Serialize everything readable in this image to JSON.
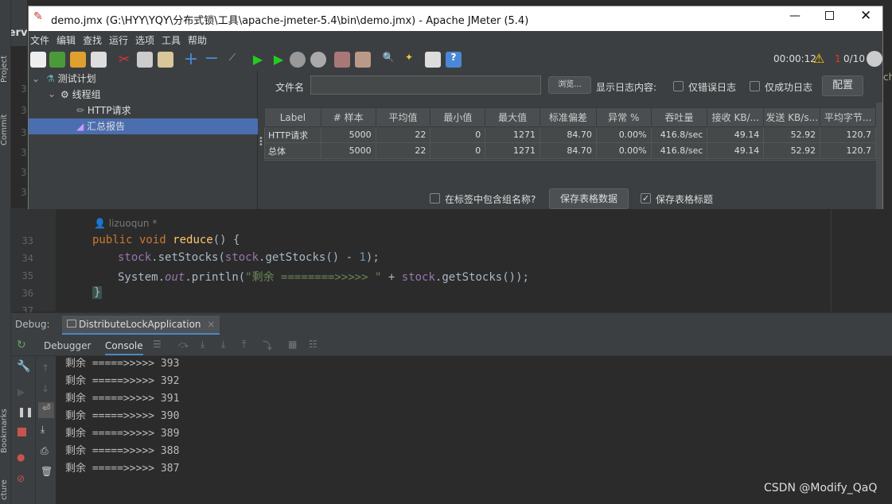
{
  "ide": {
    "top_label": "servi",
    "side_tabs": [
      "Project",
      "Commit",
      "Bookmarks",
      "cture"
    ],
    "annotation": "lizuoqun *",
    "line_numbers": [
      "33",
      "34",
      "35",
      "36",
      "37"
    ],
    "gutter_nums": [
      "3",
      "3",
      "3",
      "3",
      "3",
      "3"
    ],
    "right_clip": "chi",
    "code": {
      "l33_kw": "public void",
      "l33_fn": "reduce",
      "l33_rest": "() {",
      "l34_a": "stock",
      "l34_b": ".setStocks(",
      "l34_c": "stock",
      "l34_d": ".getStocks() - ",
      "l34_e": "1",
      "l34_f": ");",
      "l35_a": "System.",
      "l35_b": "out",
      "l35_c": ".println(",
      "l35_d": "\"剩余 ========>>>>> \"",
      "l35_e": " + ",
      "l35_f": "stock",
      "l35_g": ".getStocks());",
      "l36": "}"
    }
  },
  "debug": {
    "label": "Debug:",
    "session": "DistributeLockApplication",
    "tabs": [
      "Debugger",
      "Console"
    ],
    "console_lines": [
      "剩余 =====>>>>> 393",
      "剩余 =====>>>>> 392",
      "剩余 =====>>>>> 391",
      "剩余 =====>>>>> 390",
      "剩余 =====>>>>> 389",
      "剩余 =====>>>>> 388",
      "剩余 =====>>>>> 387"
    ]
  },
  "watermark": "CSDN @Modify_QaQ",
  "jmeter": {
    "title": "demo.jmx (G:\\HYY\\YQY\\分布式锁\\工具\\apache-jmeter-5.4\\bin\\demo.jmx) - Apache JMeter (5.4)",
    "menu": [
      "文件",
      "编辑",
      "查找",
      "运行",
      "选项",
      "工具",
      "帮助"
    ],
    "timer": "00:00:12",
    "warn_count": "1",
    "threads": "0/10",
    "tree": [
      "测试计划",
      "线程组",
      "HTTP请求",
      "汇总报告"
    ],
    "file_label": "文件名",
    "browse": "浏览...",
    "log_label": "显示日志内容:",
    "errors_only": "仅错误日志",
    "success_only": "仅成功日志",
    "configure": "配置",
    "table": {
      "headers": [
        "Label",
        "# 样本",
        "平均值",
        "最小值",
        "最大值",
        "标准偏差",
        "异常 %",
        "吞吐量",
        "接收 KB/...",
        "发送 KB/s...",
        "平均字节..."
      ],
      "rows": [
        [
          "HTTP请求",
          "5000",
          "22",
          "0",
          "1271",
          "84.70",
          "0.00%",
          "416.8/sec",
          "49.14",
          "52.92",
          "120.7"
        ],
        [
          "总体",
          "5000",
          "22",
          "0",
          "1271",
          "84.70",
          "0.00%",
          "416.8/sec",
          "49.14",
          "52.92",
          "120.7"
        ]
      ]
    },
    "include_group": "在标签中包含组名称?",
    "save_table": "保存表格数据",
    "save_header": "保存表格标题"
  }
}
